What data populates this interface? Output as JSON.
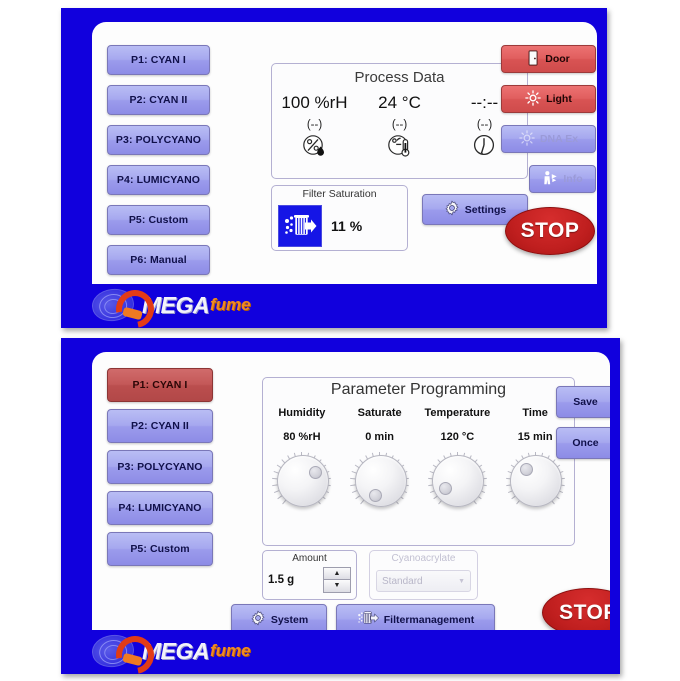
{
  "brand": {
    "omega_text": "MEGA",
    "fume_text": "fume"
  },
  "panel1": {
    "programs": [
      {
        "label": "P1: CYAN I",
        "active": false
      },
      {
        "label": "P2: CYAN II",
        "active": false
      },
      {
        "label": "P3: POLYCYANO",
        "active": false
      },
      {
        "label": "P4: LUMICYANO",
        "active": false
      },
      {
        "label": "P5: Custom",
        "active": false
      },
      {
        "label": "P6: Manual",
        "active": false
      }
    ],
    "process_data": {
      "title": "Process Data",
      "columns": [
        {
          "value": "100 %rH",
          "sub": "(--)",
          "icon": "humidity-icon"
        },
        {
          "value": "24 °C",
          "sub": "(--)",
          "icon": "temperature-icon"
        },
        {
          "value": "--:--",
          "sub": "(--)",
          "icon": "clock-icon"
        }
      ]
    },
    "filter_saturation": {
      "title": "Filter Saturation",
      "value": "11 %",
      "icon": "filter-icon"
    },
    "settings_button": {
      "label": "Settings",
      "icon": "gear-icon"
    },
    "actions": [
      {
        "label": "Door",
        "icon": "door-icon",
        "style": "red",
        "disabled": false
      },
      {
        "label": "Light",
        "icon": "light-icon",
        "style": "red",
        "disabled": false
      },
      {
        "label": "DNA Ex",
        "icon": "light-icon",
        "style": "blue",
        "disabled": true
      },
      {
        "label": "Info",
        "icon": "info-icon",
        "style": "blue",
        "disabled": true
      }
    ],
    "stop_button": {
      "label": "STOP"
    }
  },
  "panel2": {
    "programs": [
      {
        "label": "P1: CYAN I",
        "active": true
      },
      {
        "label": "P2: CYAN II",
        "active": false
      },
      {
        "label": "P3: POLYCYANO",
        "active": false
      },
      {
        "label": "P4: LUMICYANO",
        "active": false
      },
      {
        "label": "P5: Custom",
        "active": false
      }
    ],
    "parameters": {
      "title": "Parameter Programming",
      "headers": [
        "Humidity",
        "Saturate",
        "Temperature",
        "Time"
      ],
      "values": [
        "80 %rH",
        "0 min",
        "120 °C",
        "15 min"
      ],
      "knob_angles": [
        55,
        200,
        240,
        320
      ]
    },
    "amount": {
      "title": "Amount",
      "value": "1.5 g",
      "up_icon": "triangle-up-icon",
      "down_icon": "triangle-down-icon"
    },
    "cyanoacrylate": {
      "title": "Cyanoacrylate",
      "selected": "Standard",
      "disabled": true
    },
    "bottom_buttons": [
      {
        "label": "System",
        "icon": "gear-icon"
      },
      {
        "label": "Filtermanagement",
        "icon": "filter-icon"
      }
    ],
    "side_buttons": [
      {
        "label": "Save"
      },
      {
        "label": "Once"
      }
    ],
    "stop_button": {
      "label": "STOP"
    }
  },
  "colors": {
    "bezel_blue": "#1100dd",
    "button_blue": "#a6a8ef",
    "button_red": "#e05e5e",
    "selected_red": "#c45858",
    "stop_red": "#c01f1f",
    "accent_orange": "#f08a20"
  }
}
